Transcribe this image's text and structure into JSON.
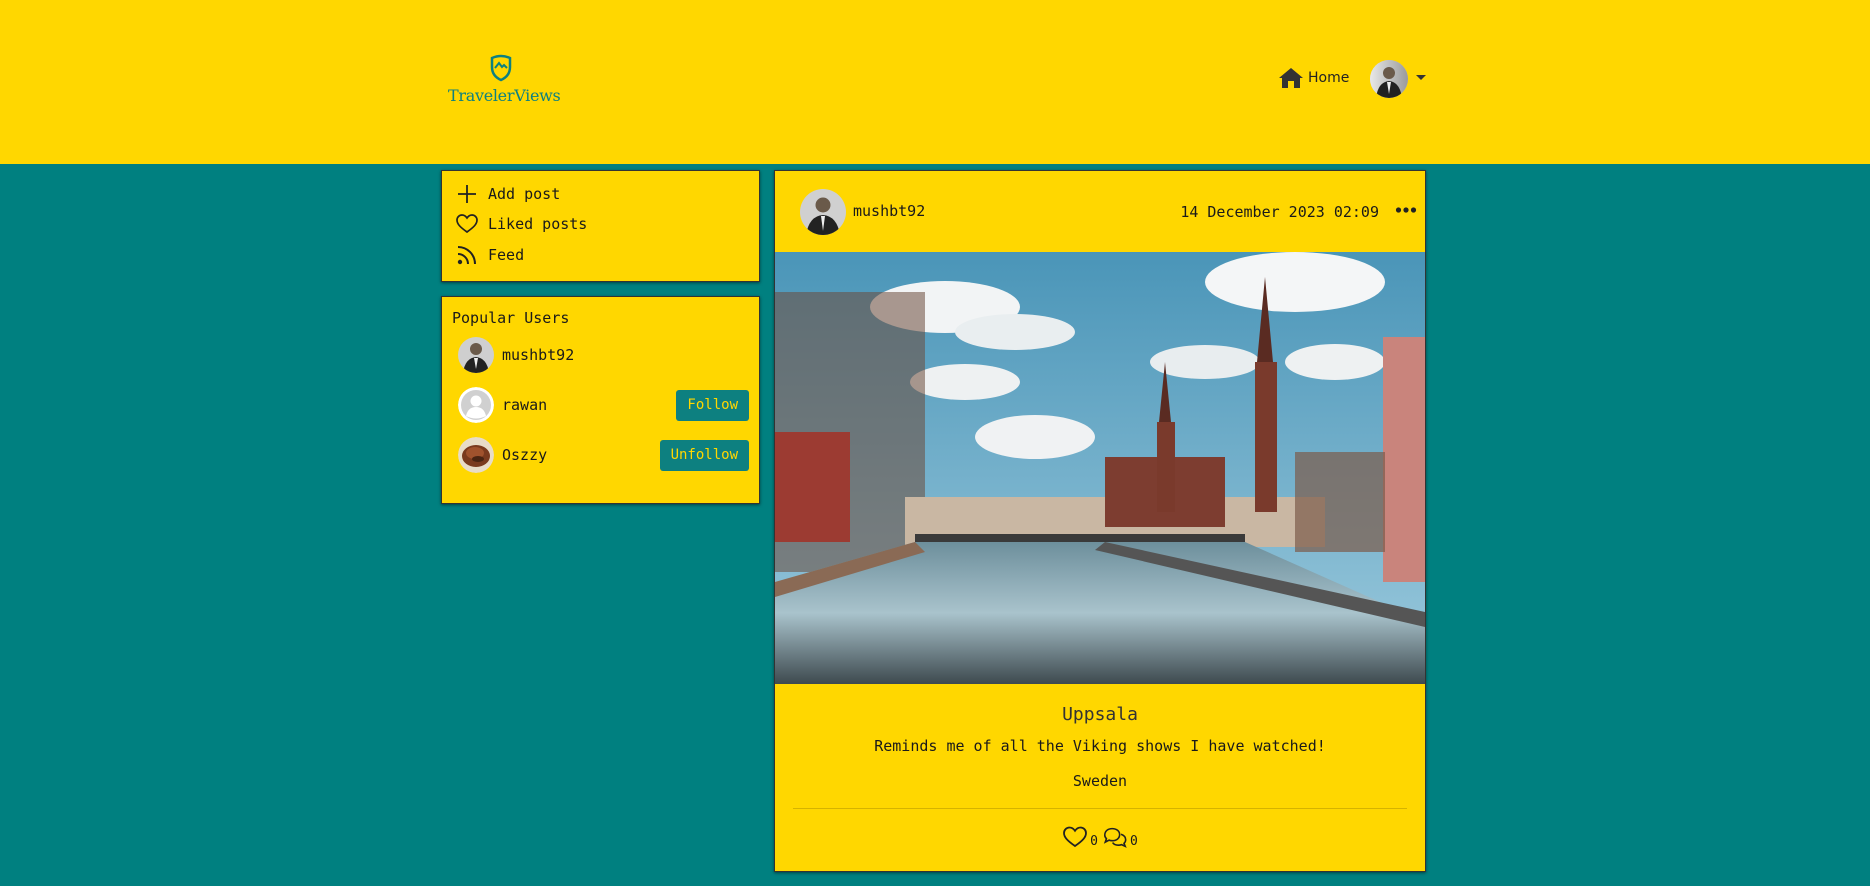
{
  "header": {
    "brand": "TravelerViews",
    "nav": {
      "home_label": "Home"
    }
  },
  "menu": {
    "items": [
      {
        "label": "Add post",
        "icon": "plus-icon"
      },
      {
        "label": "Liked posts",
        "icon": "heart-icon"
      },
      {
        "label": "Feed",
        "icon": "rss-icon"
      }
    ]
  },
  "popular": {
    "title": "Popular Users",
    "users": [
      {
        "name": "mushbt92",
        "action": ""
      },
      {
        "name": "rawan",
        "action": "Follow"
      },
      {
        "name": "Oszzy",
        "action": "Unfollow"
      }
    ]
  },
  "post": {
    "username": "mushbt92",
    "date": "14 December 2023 02:09",
    "title": "Uppsala",
    "description": "Reminds me of all the Viking shows I have watched!",
    "country": "Sweden",
    "likes": "0",
    "comments": "0"
  },
  "colors": {
    "primary": "#FFD700",
    "background": "#008080",
    "button": "#0d8080"
  }
}
